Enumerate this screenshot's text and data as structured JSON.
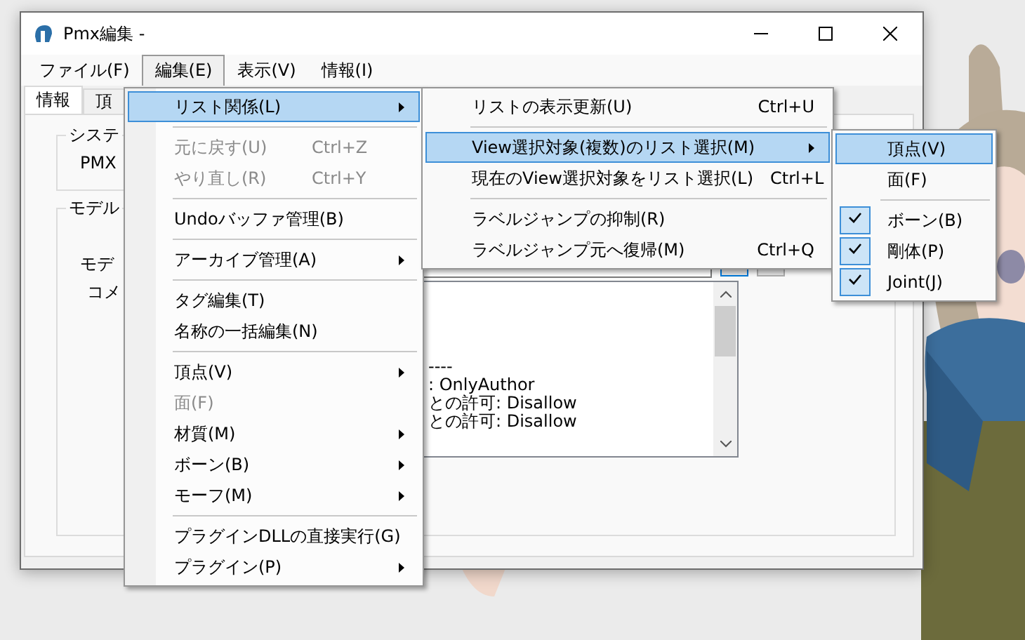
{
  "window": {
    "title": "Pmx編集 -"
  },
  "menubar": [
    {
      "label": "ファイル(F)",
      "selected": false
    },
    {
      "label": "編集(E)",
      "selected": true
    },
    {
      "label": "表示(V)",
      "selected": false
    },
    {
      "label": "情報(I)",
      "selected": false
    }
  ],
  "tabs": [
    {
      "label": "情報",
      "selected": true
    },
    {
      "label": "頂",
      "selected": false
    }
  ],
  "system_group": {
    "title": "システ",
    "label": "PMX"
  },
  "model_group": {
    "title": "モデル",
    "name_label": "モデ",
    "comment_label": "コメ",
    "comment_lines": [
      "----",
      ": OnlyAuthor",
      "との許可: Disallow",
      "との許可: Disallow"
    ]
  },
  "edit_menu": [
    {
      "kind": "item",
      "label": "リスト関係(L)",
      "submenu": true,
      "disabled": false,
      "selected": true
    },
    {
      "kind": "separator"
    },
    {
      "kind": "item",
      "label": "元に戻す(U)",
      "shortcut": "Ctrl+Z",
      "submenu": false,
      "disabled": true,
      "selected": false
    },
    {
      "kind": "item",
      "label": "やり直し(R)",
      "shortcut": "Ctrl+Y",
      "submenu": false,
      "disabled": true,
      "selected": false
    },
    {
      "kind": "separator"
    },
    {
      "kind": "item",
      "label": "Undoバッファ管理(B)",
      "submenu": false,
      "disabled": false,
      "selected": false
    },
    {
      "kind": "separator"
    },
    {
      "kind": "item",
      "label": "アーカイブ管理(A)",
      "submenu": true,
      "disabled": false,
      "selected": false
    },
    {
      "kind": "separator"
    },
    {
      "kind": "item",
      "label": "タグ編集(T)",
      "submenu": false,
      "disabled": false,
      "selected": false
    },
    {
      "kind": "item",
      "label": "名称の一括編集(N)",
      "submenu": false,
      "disabled": false,
      "selected": false
    },
    {
      "kind": "separator"
    },
    {
      "kind": "item",
      "label": "頂点(V)",
      "submenu": true,
      "disabled": false,
      "selected": false
    },
    {
      "kind": "item",
      "label": "面(F)",
      "submenu": false,
      "disabled": true,
      "selected": false
    },
    {
      "kind": "item",
      "label": "材質(M)",
      "submenu": true,
      "disabled": false,
      "selected": false
    },
    {
      "kind": "item",
      "label": "ボーン(B)",
      "submenu": true,
      "disabled": false,
      "selected": false
    },
    {
      "kind": "item",
      "label": "モーフ(M)",
      "submenu": true,
      "disabled": false,
      "selected": false
    },
    {
      "kind": "separator"
    },
    {
      "kind": "item",
      "label": "プラグインDLLの直接実行(G)",
      "submenu": false,
      "disabled": false,
      "selected": false
    },
    {
      "kind": "item",
      "label": "プラグイン(P)",
      "submenu": true,
      "disabled": false,
      "selected": false
    }
  ],
  "list_submenu": [
    {
      "kind": "item",
      "label": "リストの表示更新(U)",
      "shortcut": "Ctrl+U",
      "submenu": false,
      "selected": false
    },
    {
      "kind": "separator"
    },
    {
      "kind": "item",
      "label": "View選択対象(複数)のリスト選択(M)",
      "submenu": true,
      "selected": true
    },
    {
      "kind": "item",
      "label": "現在のView選択対象をリスト選択(L)",
      "shortcut": "Ctrl+L",
      "submenu": false,
      "selected": false
    },
    {
      "kind": "separator"
    },
    {
      "kind": "item",
      "label": "ラベルジャンプの抑制(R)",
      "submenu": false,
      "selected": false
    },
    {
      "kind": "item",
      "label": "ラベルジャンプ元へ復帰(M)",
      "shortcut": "Ctrl+Q",
      "submenu": false,
      "selected": false
    }
  ],
  "view_submenu": [
    {
      "kind": "item",
      "label": "頂点(V)",
      "checked": false,
      "selected": true
    },
    {
      "kind": "item",
      "label": "面(F)",
      "checked": false,
      "selected": false
    },
    {
      "kind": "separator"
    },
    {
      "kind": "item",
      "label": "ボーン(B)",
      "checked": true,
      "selected": false
    },
    {
      "kind": "item",
      "label": "剛体(P)",
      "checked": true,
      "selected": false
    },
    {
      "kind": "item",
      "label": "Joint(J)",
      "checked": true,
      "selected": false
    }
  ]
}
